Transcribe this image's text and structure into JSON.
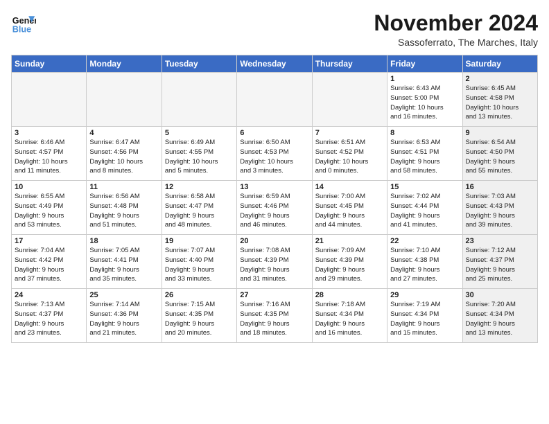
{
  "logo": {
    "line1": "General",
    "line2": "Blue"
  },
  "title": "November 2024",
  "subtitle": "Sassoferrato, The Marches, Italy",
  "days_of_week": [
    "Sunday",
    "Monday",
    "Tuesday",
    "Wednesday",
    "Thursday",
    "Friday",
    "Saturday"
  ],
  "weeks": [
    [
      {
        "day": "",
        "info": "",
        "empty": true
      },
      {
        "day": "",
        "info": "",
        "empty": true
      },
      {
        "day": "",
        "info": "",
        "empty": true
      },
      {
        "day": "",
        "info": "",
        "empty": true
      },
      {
        "day": "",
        "info": "",
        "empty": true
      },
      {
        "day": "1",
        "info": "Sunrise: 6:43 AM\nSunset: 5:00 PM\nDaylight: 10 hours\nand 16 minutes."
      },
      {
        "day": "2",
        "info": "Sunrise: 6:45 AM\nSunset: 4:58 PM\nDaylight: 10 hours\nand 13 minutes."
      }
    ],
    [
      {
        "day": "3",
        "info": "Sunrise: 6:46 AM\nSunset: 4:57 PM\nDaylight: 10 hours\nand 11 minutes."
      },
      {
        "day": "4",
        "info": "Sunrise: 6:47 AM\nSunset: 4:56 PM\nDaylight: 10 hours\nand 8 minutes."
      },
      {
        "day": "5",
        "info": "Sunrise: 6:49 AM\nSunset: 4:55 PM\nDaylight: 10 hours\nand 5 minutes."
      },
      {
        "day": "6",
        "info": "Sunrise: 6:50 AM\nSunset: 4:53 PM\nDaylight: 10 hours\nand 3 minutes."
      },
      {
        "day": "7",
        "info": "Sunrise: 6:51 AM\nSunset: 4:52 PM\nDaylight: 10 hours\nand 0 minutes."
      },
      {
        "day": "8",
        "info": "Sunrise: 6:53 AM\nSunset: 4:51 PM\nDaylight: 9 hours\nand 58 minutes."
      },
      {
        "day": "9",
        "info": "Sunrise: 6:54 AM\nSunset: 4:50 PM\nDaylight: 9 hours\nand 55 minutes."
      }
    ],
    [
      {
        "day": "10",
        "info": "Sunrise: 6:55 AM\nSunset: 4:49 PM\nDaylight: 9 hours\nand 53 minutes."
      },
      {
        "day": "11",
        "info": "Sunrise: 6:56 AM\nSunset: 4:48 PM\nDaylight: 9 hours\nand 51 minutes."
      },
      {
        "day": "12",
        "info": "Sunrise: 6:58 AM\nSunset: 4:47 PM\nDaylight: 9 hours\nand 48 minutes."
      },
      {
        "day": "13",
        "info": "Sunrise: 6:59 AM\nSunset: 4:46 PM\nDaylight: 9 hours\nand 46 minutes."
      },
      {
        "day": "14",
        "info": "Sunrise: 7:00 AM\nSunset: 4:45 PM\nDaylight: 9 hours\nand 44 minutes."
      },
      {
        "day": "15",
        "info": "Sunrise: 7:02 AM\nSunset: 4:44 PM\nDaylight: 9 hours\nand 41 minutes."
      },
      {
        "day": "16",
        "info": "Sunrise: 7:03 AM\nSunset: 4:43 PM\nDaylight: 9 hours\nand 39 minutes."
      }
    ],
    [
      {
        "day": "17",
        "info": "Sunrise: 7:04 AM\nSunset: 4:42 PM\nDaylight: 9 hours\nand 37 minutes."
      },
      {
        "day": "18",
        "info": "Sunrise: 7:05 AM\nSunset: 4:41 PM\nDaylight: 9 hours\nand 35 minutes."
      },
      {
        "day": "19",
        "info": "Sunrise: 7:07 AM\nSunset: 4:40 PM\nDaylight: 9 hours\nand 33 minutes."
      },
      {
        "day": "20",
        "info": "Sunrise: 7:08 AM\nSunset: 4:39 PM\nDaylight: 9 hours\nand 31 minutes."
      },
      {
        "day": "21",
        "info": "Sunrise: 7:09 AM\nSunset: 4:39 PM\nDaylight: 9 hours\nand 29 minutes."
      },
      {
        "day": "22",
        "info": "Sunrise: 7:10 AM\nSunset: 4:38 PM\nDaylight: 9 hours\nand 27 minutes."
      },
      {
        "day": "23",
        "info": "Sunrise: 7:12 AM\nSunset: 4:37 PM\nDaylight: 9 hours\nand 25 minutes."
      }
    ],
    [
      {
        "day": "24",
        "info": "Sunrise: 7:13 AM\nSunset: 4:37 PM\nDaylight: 9 hours\nand 23 minutes."
      },
      {
        "day": "25",
        "info": "Sunrise: 7:14 AM\nSunset: 4:36 PM\nDaylight: 9 hours\nand 21 minutes."
      },
      {
        "day": "26",
        "info": "Sunrise: 7:15 AM\nSunset: 4:35 PM\nDaylight: 9 hours\nand 20 minutes."
      },
      {
        "day": "27",
        "info": "Sunrise: 7:16 AM\nSunset: 4:35 PM\nDaylight: 9 hours\nand 18 minutes."
      },
      {
        "day": "28",
        "info": "Sunrise: 7:18 AM\nSunset: 4:34 PM\nDaylight: 9 hours\nand 16 minutes."
      },
      {
        "day": "29",
        "info": "Sunrise: 7:19 AM\nSunset: 4:34 PM\nDaylight: 9 hours\nand 15 minutes."
      },
      {
        "day": "30",
        "info": "Sunrise: 7:20 AM\nSunset: 4:34 PM\nDaylight: 9 hours\nand 13 minutes."
      }
    ]
  ]
}
